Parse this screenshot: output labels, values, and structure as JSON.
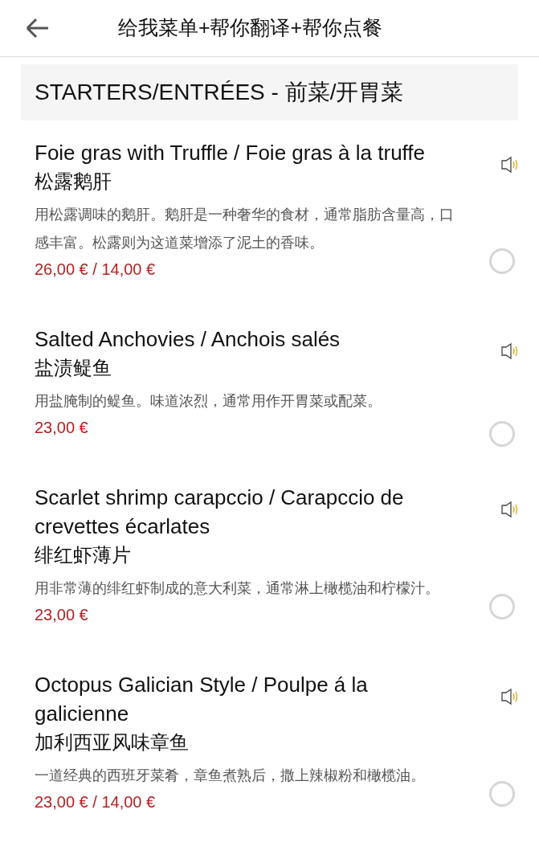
{
  "header": {
    "title": "给我菜单+帮你翻译+帮你点餐"
  },
  "section": {
    "title": "STARTERS/ENTRÉES - 前菜/开胃菜"
  },
  "dishes": [
    {
      "name": "Foie gras with Truffle / Foie gras à la truffe",
      "name_zh": "松露鹅肝",
      "description": "用松露调味的鹅肝。鹅肝是一种奢华的食材，通常脂肪含量高，口感丰富。松露则为这道菜增添了泥土的香味。",
      "price": "26,00 € / 14,00 €",
      "selected": false
    },
    {
      "name": "Salted Anchovies / Anchois salés",
      "name_zh": "盐渍鳀鱼",
      "description": "用盐腌制的鳀鱼。味道浓烈，通常用作开胃菜或配菜。",
      "price": "23,00 €",
      "selected": false
    },
    {
      "name": "Scarlet shrimp carapccio / Carapccio de crevettes écarlates",
      "name_zh": "绯红虾薄片",
      "description": "用非常薄的绯红虾制成的意大利菜，通常淋上橄榄油和柠檬汁。",
      "price": "23,00 €",
      "selected": false
    },
    {
      "name": "Octopus Galician Style / Poulpe á la galicienne",
      "name_zh": "加利西亚风味章鱼",
      "description": "一道经典的西班牙菜肴，章鱼煮熟后，撒上辣椒粉和橄榄油。",
      "price": "23,00 € / 14,00 €",
      "selected": false
    }
  ]
}
